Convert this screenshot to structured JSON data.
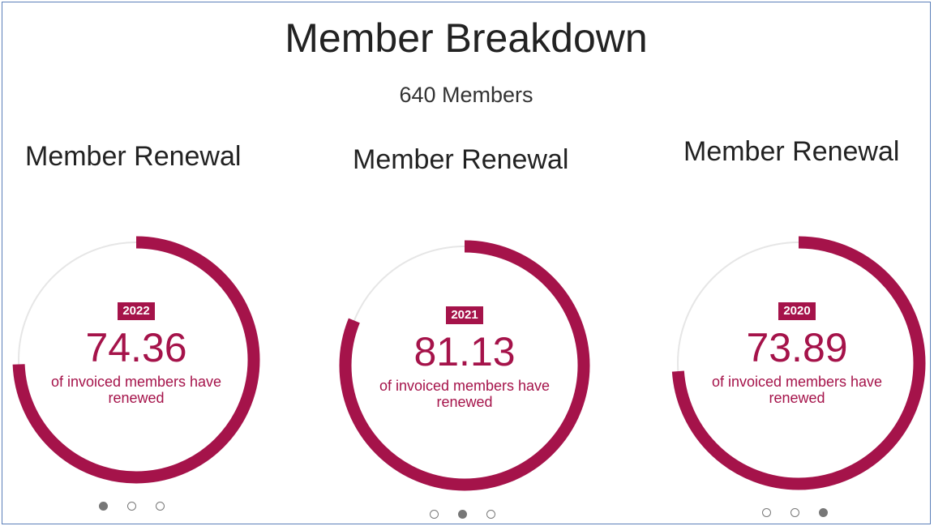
{
  "header": {
    "title": "Member Breakdown",
    "member_count": "640 Members"
  },
  "colors": {
    "accent": "#a5134a",
    "track": "#e6e6e6",
    "dot": "#777777"
  },
  "cards": [
    {
      "title": "Member Renewal",
      "year": "2022",
      "value": "74.36",
      "fraction": 0.7436,
      "caption": "of invoiced members have renewed",
      "active_dot": 0
    },
    {
      "title": "Member Renewal",
      "year": "2021",
      "value": "81.13",
      "fraction": 0.8113,
      "caption": "of invoiced members have renewed",
      "active_dot": 1
    },
    {
      "title": "Member Renewal",
      "year": "2020",
      "value": "73.89",
      "fraction": 0.7389,
      "caption": "of invoiced members have renewed",
      "active_dot": 2
    }
  ]
}
